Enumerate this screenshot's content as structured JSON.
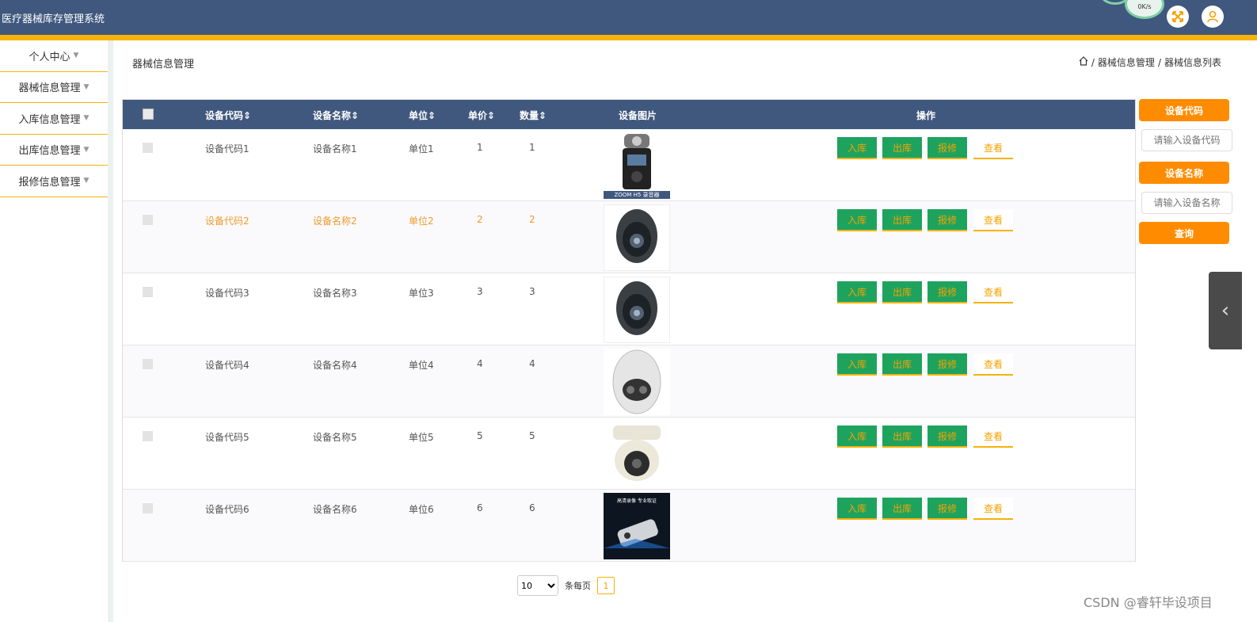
{
  "app": {
    "title": "医疗器械库存管理系统",
    "speed": "0K/s"
  },
  "colors": {
    "header": "#40587e",
    "accent": "#f5b30a",
    "button_green": "#1ea35e",
    "label_orange": "#ff8c00"
  },
  "sidebar": {
    "items": [
      {
        "label": "个人中心"
      },
      {
        "label": "器械信息管理"
      },
      {
        "label": "入库信息管理"
      },
      {
        "label": "出库信息管理"
      },
      {
        "label": "报修信息管理"
      }
    ]
  },
  "page": {
    "title": "器械信息管理"
  },
  "breadcrumb": {
    "level1": "器械信息管理",
    "level2": "器械信息列表"
  },
  "table": {
    "headers": {
      "code": "设备代码",
      "name": "设备名称",
      "unit": "单位",
      "price": "单价",
      "qty": "数量",
      "image": "设备图片",
      "actions": "操作"
    },
    "actions": {
      "in": "入库",
      "out": "出库",
      "repair": "报修",
      "view": "查看"
    },
    "rows": [
      {
        "code": "设备代码1",
        "name": "设备名称1",
        "unit": "单位1",
        "price": "1",
        "qty": "1",
        "image": "ZOOM H5 录音器",
        "image_icon": "recorder"
      },
      {
        "code": "设备代码2",
        "name": "设备名称2",
        "unit": "单位2",
        "price": "2",
        "qty": "2",
        "image": "",
        "image_icon": "dome-camera-dark"
      },
      {
        "code": "设备代码3",
        "name": "设备名称3",
        "unit": "单位3",
        "price": "3",
        "qty": "3",
        "image": "",
        "image_icon": "dome-camera-dark"
      },
      {
        "code": "设备代码4",
        "name": "设备名称4",
        "unit": "单位4",
        "price": "4",
        "qty": "4",
        "image": "",
        "image_icon": "dome-camera-white"
      },
      {
        "code": "设备代码5",
        "name": "设备名称5",
        "unit": "单位5",
        "price": "5",
        "qty": "5",
        "image": "",
        "image_icon": "dome-camera-beige"
      },
      {
        "code": "设备代码6",
        "name": "设备名称6",
        "unit": "单位6",
        "price": "6",
        "qty": "6",
        "image": "高清录像 专业取证",
        "image_icon": "pen-recorder"
      }
    ]
  },
  "search": {
    "code_label": "设备代码",
    "code_placeholder": "请输入设备代码",
    "name_label": "设备名称",
    "name_placeholder": "请输入设备名称",
    "query_button": "查询"
  },
  "pager": {
    "page_size": "10",
    "per_page_label": "条每页",
    "current_page": "1"
  },
  "watermark": "CSDN @睿轩毕设项目"
}
